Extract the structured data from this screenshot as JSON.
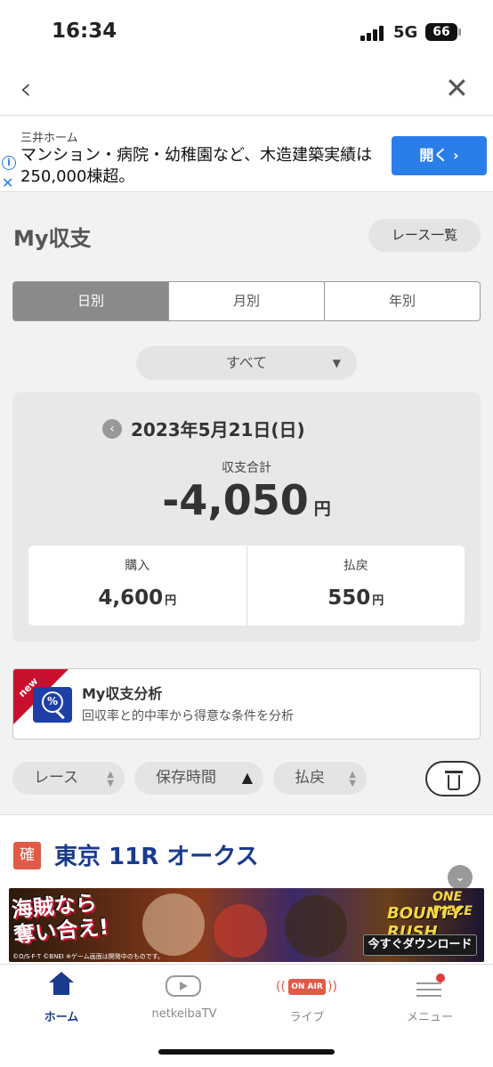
{
  "status_bar": {
    "time": "16:34",
    "network": "5G",
    "battery": "66"
  },
  "ad_top": {
    "sponsor": "三井ホーム",
    "text": "マンション・病院・幼稚園など、木造建築実績は250,000棟超。",
    "button": "開く ›"
  },
  "header": {
    "title": "My収支",
    "race_list_button": "レース一覧"
  },
  "period_tabs": [
    {
      "label": "日別",
      "active": true
    },
    {
      "label": "月別",
      "active": false
    },
    {
      "label": "年別",
      "active": false
    }
  ],
  "filter": {
    "selected": "すべて"
  },
  "summary": {
    "date": "2023年5月21日(日)",
    "total_label": "収支合計",
    "total_value": "-4,050",
    "unit": "円",
    "purchase_label": "購入",
    "purchase_value": "4,600",
    "payout_label": "払戻",
    "payout_value": "550"
  },
  "analysis": {
    "badge": "new",
    "title": "My収支分析",
    "description": "回収率と的中率から得意な条件を分析"
  },
  "sort": {
    "race": "レース",
    "saved_time": "保存時間",
    "payout": "払戻"
  },
  "race": {
    "badge": "確",
    "title": "東京 11R オークス"
  },
  "ad_banner": {
    "headline": "海賊なら\n奪い合え!",
    "brand": "BOUNTY RUSH",
    "logo": "ONE PIECE",
    "cta": "今すぐダウンロード",
    "copyright": "©O/S·F·T ©BNEI ※ゲーム画面は開発中のものです。"
  },
  "tabbar": {
    "items": [
      {
        "label": "ホーム",
        "active": true
      },
      {
        "label": "netkeibaTV",
        "active": false
      },
      {
        "label": "ライブ",
        "active": false,
        "badge": "ON AIR"
      },
      {
        "label": "メニュー",
        "active": false
      }
    ]
  },
  "colors": {
    "accent": "#1a3a8c",
    "badge_red": "#e05a47",
    "ad_button": "#2b7de9"
  }
}
